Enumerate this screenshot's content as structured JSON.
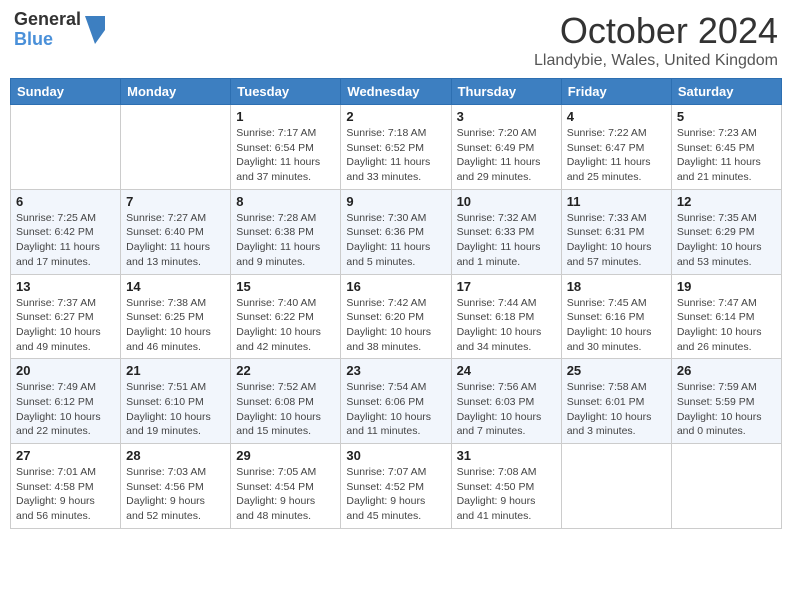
{
  "logo": {
    "general": "General",
    "blue": "Blue"
  },
  "header": {
    "month": "October 2024",
    "location": "Llandybie, Wales, United Kingdom"
  },
  "weekdays": [
    "Sunday",
    "Monday",
    "Tuesday",
    "Wednesday",
    "Thursday",
    "Friday",
    "Saturday"
  ],
  "weeks": [
    [
      {
        "day": "",
        "info": ""
      },
      {
        "day": "",
        "info": ""
      },
      {
        "day": "1",
        "info": "Sunrise: 7:17 AM\nSunset: 6:54 PM\nDaylight: 11 hours and 37 minutes."
      },
      {
        "day": "2",
        "info": "Sunrise: 7:18 AM\nSunset: 6:52 PM\nDaylight: 11 hours and 33 minutes."
      },
      {
        "day": "3",
        "info": "Sunrise: 7:20 AM\nSunset: 6:49 PM\nDaylight: 11 hours and 29 minutes."
      },
      {
        "day": "4",
        "info": "Sunrise: 7:22 AM\nSunset: 6:47 PM\nDaylight: 11 hours and 25 minutes."
      },
      {
        "day": "5",
        "info": "Sunrise: 7:23 AM\nSunset: 6:45 PM\nDaylight: 11 hours and 21 minutes."
      }
    ],
    [
      {
        "day": "6",
        "info": "Sunrise: 7:25 AM\nSunset: 6:42 PM\nDaylight: 11 hours and 17 minutes."
      },
      {
        "day": "7",
        "info": "Sunrise: 7:27 AM\nSunset: 6:40 PM\nDaylight: 11 hours and 13 minutes."
      },
      {
        "day": "8",
        "info": "Sunrise: 7:28 AM\nSunset: 6:38 PM\nDaylight: 11 hours and 9 minutes."
      },
      {
        "day": "9",
        "info": "Sunrise: 7:30 AM\nSunset: 6:36 PM\nDaylight: 11 hours and 5 minutes."
      },
      {
        "day": "10",
        "info": "Sunrise: 7:32 AM\nSunset: 6:33 PM\nDaylight: 11 hours and 1 minute."
      },
      {
        "day": "11",
        "info": "Sunrise: 7:33 AM\nSunset: 6:31 PM\nDaylight: 10 hours and 57 minutes."
      },
      {
        "day": "12",
        "info": "Sunrise: 7:35 AM\nSunset: 6:29 PM\nDaylight: 10 hours and 53 minutes."
      }
    ],
    [
      {
        "day": "13",
        "info": "Sunrise: 7:37 AM\nSunset: 6:27 PM\nDaylight: 10 hours and 49 minutes."
      },
      {
        "day": "14",
        "info": "Sunrise: 7:38 AM\nSunset: 6:25 PM\nDaylight: 10 hours and 46 minutes."
      },
      {
        "day": "15",
        "info": "Sunrise: 7:40 AM\nSunset: 6:22 PM\nDaylight: 10 hours and 42 minutes."
      },
      {
        "day": "16",
        "info": "Sunrise: 7:42 AM\nSunset: 6:20 PM\nDaylight: 10 hours and 38 minutes."
      },
      {
        "day": "17",
        "info": "Sunrise: 7:44 AM\nSunset: 6:18 PM\nDaylight: 10 hours and 34 minutes."
      },
      {
        "day": "18",
        "info": "Sunrise: 7:45 AM\nSunset: 6:16 PM\nDaylight: 10 hours and 30 minutes."
      },
      {
        "day": "19",
        "info": "Sunrise: 7:47 AM\nSunset: 6:14 PM\nDaylight: 10 hours and 26 minutes."
      }
    ],
    [
      {
        "day": "20",
        "info": "Sunrise: 7:49 AM\nSunset: 6:12 PM\nDaylight: 10 hours and 22 minutes."
      },
      {
        "day": "21",
        "info": "Sunrise: 7:51 AM\nSunset: 6:10 PM\nDaylight: 10 hours and 19 minutes."
      },
      {
        "day": "22",
        "info": "Sunrise: 7:52 AM\nSunset: 6:08 PM\nDaylight: 10 hours and 15 minutes."
      },
      {
        "day": "23",
        "info": "Sunrise: 7:54 AM\nSunset: 6:06 PM\nDaylight: 10 hours and 11 minutes."
      },
      {
        "day": "24",
        "info": "Sunrise: 7:56 AM\nSunset: 6:03 PM\nDaylight: 10 hours and 7 minutes."
      },
      {
        "day": "25",
        "info": "Sunrise: 7:58 AM\nSunset: 6:01 PM\nDaylight: 10 hours and 3 minutes."
      },
      {
        "day": "26",
        "info": "Sunrise: 7:59 AM\nSunset: 5:59 PM\nDaylight: 10 hours and 0 minutes."
      }
    ],
    [
      {
        "day": "27",
        "info": "Sunrise: 7:01 AM\nSunset: 4:58 PM\nDaylight: 9 hours and 56 minutes."
      },
      {
        "day": "28",
        "info": "Sunrise: 7:03 AM\nSunset: 4:56 PM\nDaylight: 9 hours and 52 minutes."
      },
      {
        "day": "29",
        "info": "Sunrise: 7:05 AM\nSunset: 4:54 PM\nDaylight: 9 hours and 48 minutes."
      },
      {
        "day": "30",
        "info": "Sunrise: 7:07 AM\nSunset: 4:52 PM\nDaylight: 9 hours and 45 minutes."
      },
      {
        "day": "31",
        "info": "Sunrise: 7:08 AM\nSunset: 4:50 PM\nDaylight: 9 hours and 41 minutes."
      },
      {
        "day": "",
        "info": ""
      },
      {
        "day": "",
        "info": ""
      }
    ]
  ]
}
